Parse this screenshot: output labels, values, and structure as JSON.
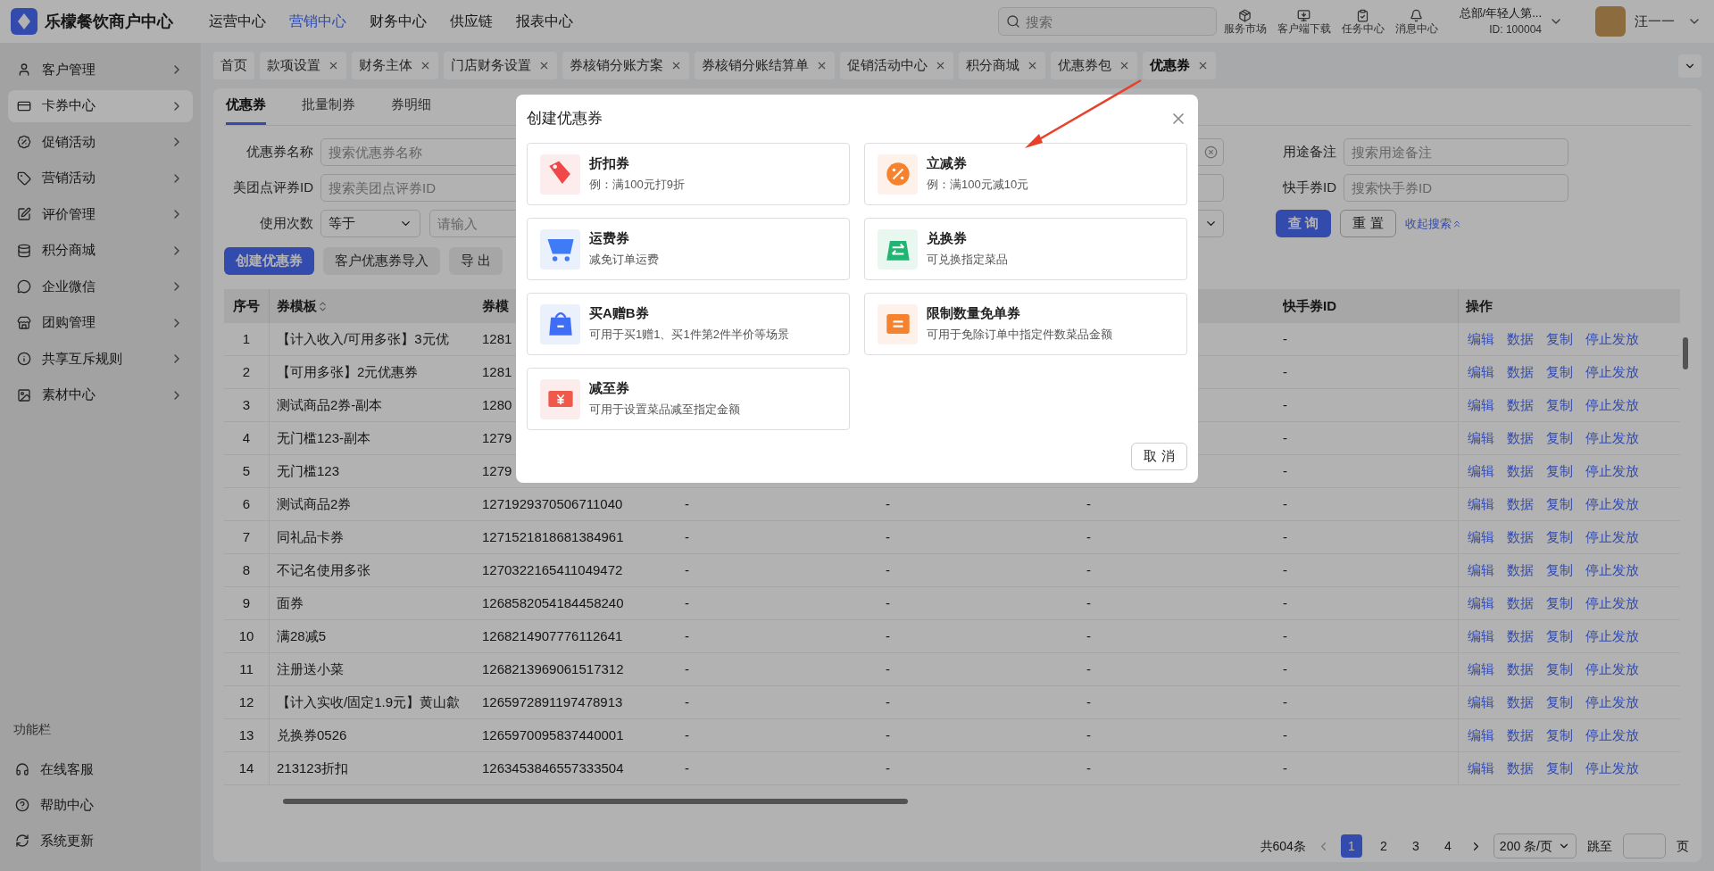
{
  "app": {
    "logo_text": "乐檬餐饮商户中心"
  },
  "top_nav": [
    {
      "label": "运营中心",
      "selected": false
    },
    {
      "label": "营销中心",
      "selected": true
    },
    {
      "label": "财务中心",
      "selected": false
    },
    {
      "label": "供应链",
      "selected": false
    },
    {
      "label": "报表中心",
      "selected": false
    }
  ],
  "search": {
    "placeholder": "搜索"
  },
  "toolbar": [
    {
      "label": "服务市场"
    },
    {
      "label": "客户端下载"
    },
    {
      "label": "任务中心"
    },
    {
      "label": "消息中心"
    }
  ],
  "account": {
    "org": "总部/年轻人第...",
    "id": "ID: 100004"
  },
  "user": {
    "name": "汪一一"
  },
  "sidebar": {
    "items": [
      {
        "label": "客户管理",
        "selected": false
      },
      {
        "label": "卡券中心",
        "selected": true
      },
      {
        "label": "促销活动",
        "selected": false
      },
      {
        "label": "营销活动",
        "selected": false
      },
      {
        "label": "评价管理",
        "selected": false
      },
      {
        "label": "积分商城",
        "selected": false
      },
      {
        "label": "企业微信",
        "selected": false
      },
      {
        "label": "团购管理",
        "selected": false
      },
      {
        "label": "共享互斥规则",
        "selected": false
      },
      {
        "label": "素材中心",
        "selected": false
      }
    ],
    "footer_title": "功能栏",
    "footer_items": [
      {
        "label": "在线客服"
      },
      {
        "label": "帮助中心"
      },
      {
        "label": "系统更新"
      }
    ]
  },
  "page_tabs": [
    {
      "label": "首页",
      "selected": false,
      "closable": false
    },
    {
      "label": "款项设置",
      "selected": false,
      "closable": true
    },
    {
      "label": "财务主体",
      "selected": false,
      "closable": true
    },
    {
      "label": "门店财务设置",
      "selected": false,
      "closable": true
    },
    {
      "label": "券核销分账方案",
      "selected": false,
      "closable": true
    },
    {
      "label": "券核销分账结算单",
      "selected": false,
      "closable": true
    },
    {
      "label": "促销活动中心",
      "selected": false,
      "closable": true
    },
    {
      "label": "积分商城",
      "selected": false,
      "closable": true
    },
    {
      "label": "优惠券包",
      "selected": false,
      "closable": true
    },
    {
      "label": "优惠券",
      "selected": true,
      "closable": true
    }
  ],
  "sub_tabs": [
    {
      "label": "优惠券",
      "selected": true
    },
    {
      "label": "批量制券",
      "selected": false
    },
    {
      "label": "券明细",
      "selected": false
    }
  ],
  "filters": {
    "left": [
      {
        "kind": "text",
        "label": "优惠券名称",
        "placeholder": "搜索优惠券名称"
      },
      {
        "kind": "text",
        "label": "美团点评券ID",
        "placeholder": "搜索美团点评券ID"
      },
      {
        "kind": "count",
        "label": "使用次数",
        "value": "等于",
        "placeholder": "请输入"
      }
    ],
    "right": [
      {
        "label": "用途备注",
        "placeholder": "搜索用途备注"
      },
      {
        "label": "快手券ID",
        "placeholder": "搜索快手券ID"
      }
    ],
    "query_button": "查 询",
    "reset_button": "重 置",
    "collapse_link": "收起搜索"
  },
  "actions": [
    {
      "label": "创建优惠券",
      "primary": true
    },
    {
      "label": "客户优惠券导入",
      "primary": false
    },
    {
      "label": "导 出",
      "primary": false
    }
  ],
  "table": {
    "columns": [
      {
        "label": "序号"
      },
      {
        "label": "券模板",
        "sortable": true
      },
      {
        "label": "券模"
      },
      {
        "label": "快手券ID"
      },
      {
        "label": "操作"
      }
    ],
    "rows": [
      {
        "seq": "1",
        "template": "【计入收入/可用多张】3元优",
        "template_id": "1281",
        "kuaishou_id": "-",
        "actions": [
          "编辑",
          "数据",
          "复制",
          "停止发放"
        ]
      },
      {
        "seq": "2",
        "template": "【可用多张】2元优惠券",
        "template_id": "1281",
        "kuaishou_id": "-",
        "actions": [
          "编辑",
          "数据",
          "复制",
          "停止发放"
        ]
      },
      {
        "seq": "3",
        "template": "测试商品2券-副本",
        "template_id": "1280",
        "kuaishou_id": "-",
        "actions": [
          "编辑",
          "数据",
          "复制",
          "停止发放"
        ]
      },
      {
        "seq": "4",
        "template": "无门槛123-副本",
        "template_id": "1279",
        "kuaishou_id": "-",
        "actions": [
          "编辑",
          "数据",
          "复制",
          "停止发放"
        ]
      },
      {
        "seq": "5",
        "template": "无门槛123",
        "template_id": "1279",
        "kuaishou_id": "-",
        "actions": [
          "编辑",
          "数据",
          "复制",
          "停止发放"
        ]
      },
      {
        "seq": "6",
        "template": "测试商品2券",
        "template_id": "1271929370506711040",
        "column_4": "-",
        "column_5": "-",
        "column_6": "-",
        "kuaishou_id": "-",
        "actions": [
          "编辑",
          "数据",
          "复制",
          "停止发放"
        ]
      },
      {
        "seq": "7",
        "template": "同礼品卡券",
        "template_id": "1271521818681384961",
        "column_4": "-",
        "column_5": "-",
        "column_6": "-",
        "kuaishou_id": "-",
        "actions": [
          "编辑",
          "数据",
          "复制",
          "停止发放"
        ]
      },
      {
        "seq": "8",
        "template": "不记名使用多张",
        "template_id": "1270322165411049472",
        "column_4": "-",
        "column_5": "-",
        "column_6": "-",
        "kuaishou_id": "-",
        "actions": [
          "编辑",
          "数据",
          "复制",
          "停止发放"
        ]
      },
      {
        "seq": "9",
        "template": "面券",
        "template_id": "1268582054184458240",
        "column_4": "-",
        "column_5": "-",
        "column_6": "-",
        "kuaishou_id": "-",
        "actions": [
          "编辑",
          "数据",
          "复制",
          "停止发放"
        ]
      },
      {
        "seq": "10",
        "template": "满28减5",
        "template_id": "1268214907776112641",
        "column_4": "-",
        "column_5": "-",
        "column_6": "-",
        "kuaishou_id": "-",
        "actions": [
          "编辑",
          "数据",
          "复制",
          "停止发放"
        ]
      },
      {
        "seq": "11",
        "template": "注册送小菜",
        "template_id": "1268213969061517312",
        "column_4": "-",
        "column_5": "-",
        "column_6": "-",
        "kuaishou_id": "-",
        "actions": [
          "编辑",
          "数据",
          "复制",
          "停止发放"
        ]
      },
      {
        "seq": "12",
        "template": "【计入实收/固定1.9元】黄山歙",
        "template_id": "1265972891197478913",
        "column_4": "-",
        "column_5": "-",
        "column_6": "-",
        "kuaishou_id": "-",
        "actions": [
          "编辑",
          "数据",
          "复制",
          "停止发放"
        ]
      },
      {
        "seq": "13",
        "template": "兑换券0526",
        "template_id": "1265970095837440001",
        "column_4": "-",
        "column_5": "-",
        "column_6": "-",
        "kuaishou_id": "-",
        "actions": [
          "编辑",
          "数据",
          "复制",
          "停止发放"
        ]
      },
      {
        "seq": "14",
        "template": "213123折扣",
        "template_id": "1263453846557333504",
        "column_4": "-",
        "column_5": "-",
        "column_6": "-",
        "kuaishou_id": "-",
        "actions": [
          "编辑",
          "数据",
          "复制",
          "停止发放"
        ]
      }
    ]
  },
  "pagination": {
    "total": "共604条",
    "pages": [
      {
        "label": "1",
        "selected": true
      },
      {
        "label": "2",
        "selected": false
      },
      {
        "label": "3",
        "selected": false
      },
      {
        "label": "4",
        "selected": false
      }
    ],
    "page_size": "200 条/页",
    "jump_label": "跳至",
    "page_suffix": "页"
  },
  "modal": {
    "title": "创建优惠券",
    "options": [
      {
        "kind": "discount",
        "title": "折扣券",
        "desc": "例：满100元打9折"
      },
      {
        "kind": "reduce",
        "title": "立减券",
        "desc": "例：满100元减10元"
      },
      {
        "kind": "shipping",
        "title": "运费券",
        "desc": "减免订单运费"
      },
      {
        "kind": "exchange",
        "title": "兑换券",
        "desc": "可兑换指定菜品"
      },
      {
        "kind": "buy_gift",
        "title": "买A赠B券",
        "desc": "可用于买1赠1、买1件第2件半价等场景"
      },
      {
        "kind": "free_limit",
        "title": "限制数量免单券",
        "desc": "可用于免除订单中指定件数菜品金额"
      },
      {
        "kind": "reduce_to",
        "title": "减至券",
        "desc": "可用于设置菜品减至指定金额"
      }
    ],
    "cancel": "取 消"
  }
}
